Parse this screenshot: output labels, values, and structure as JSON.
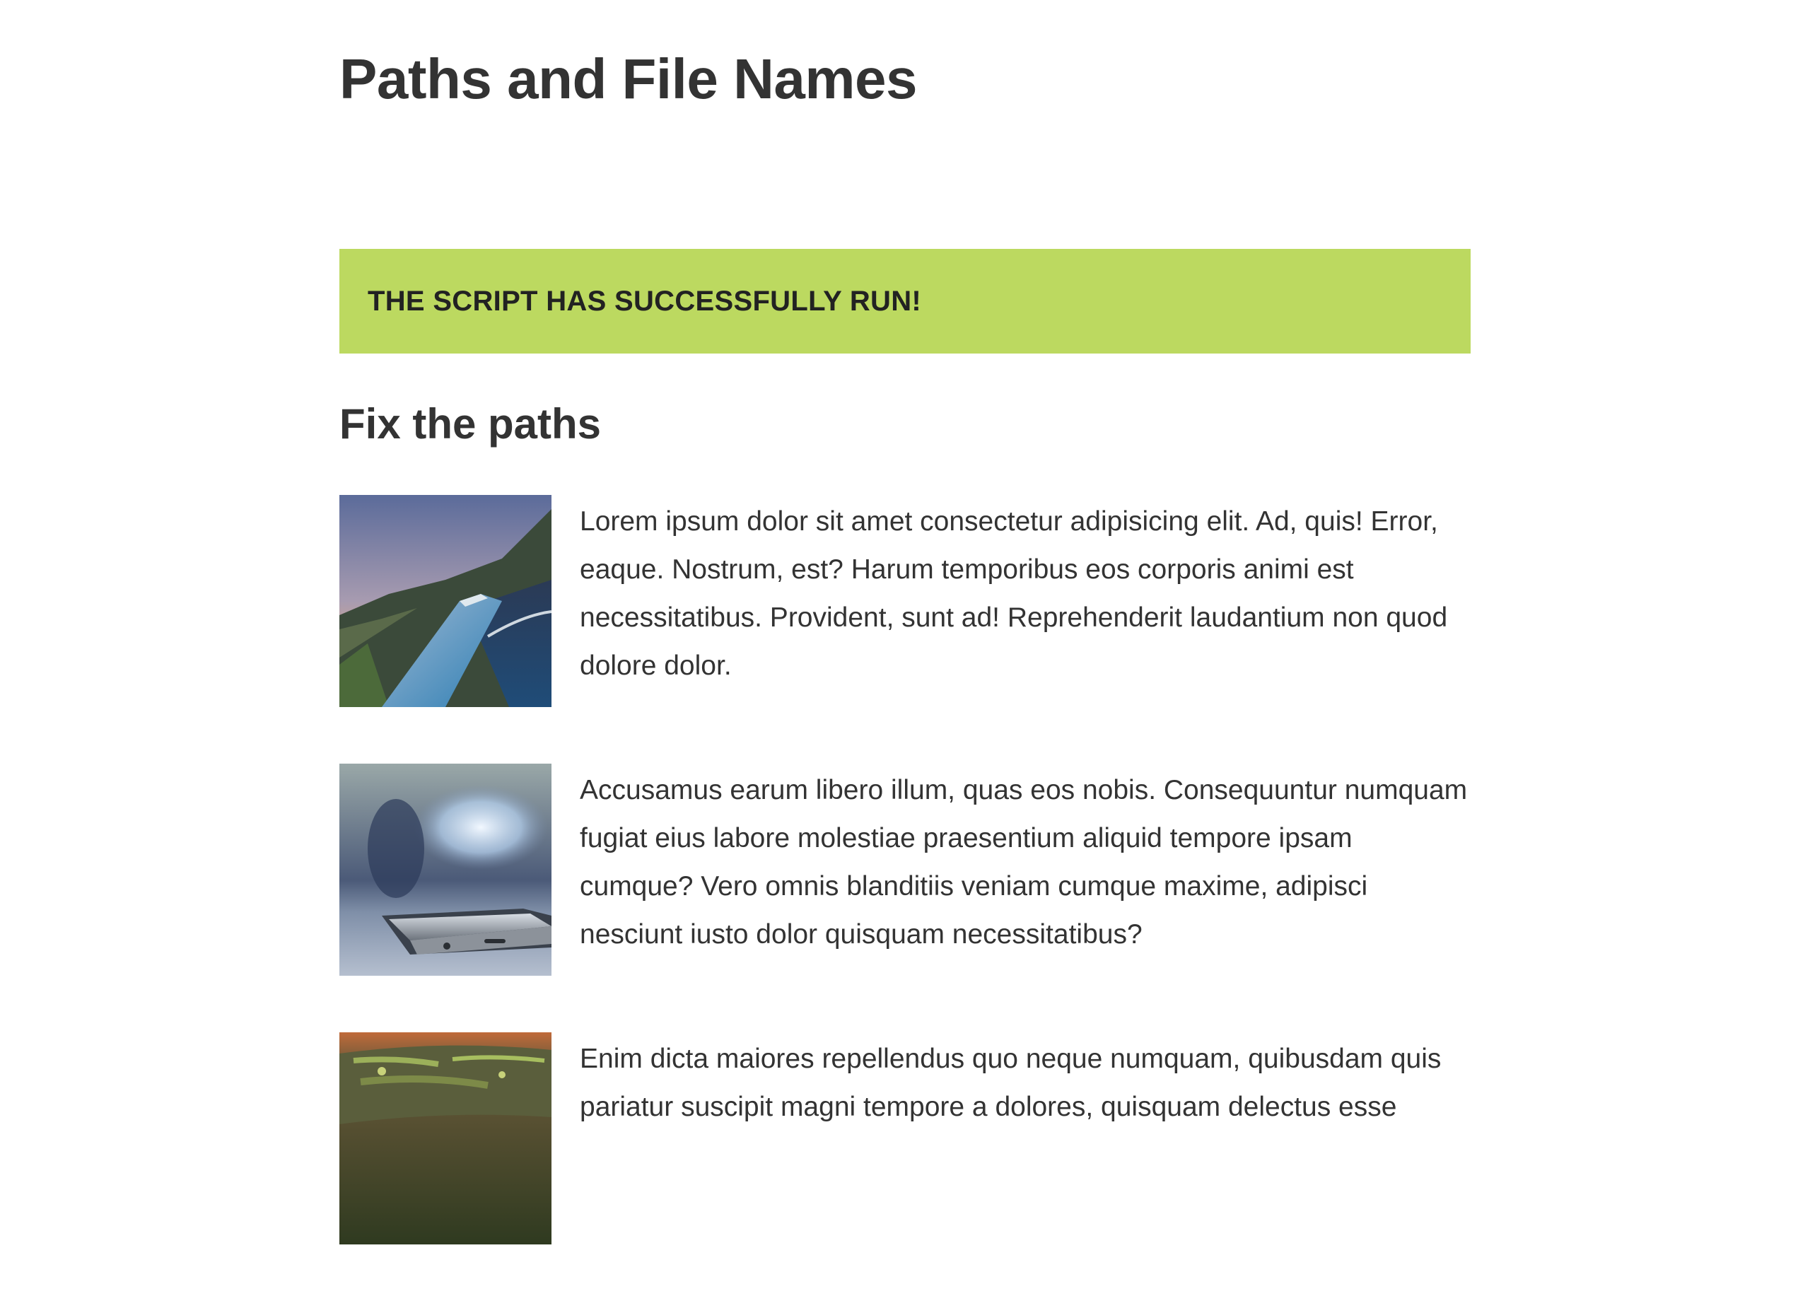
{
  "page": {
    "title": "Paths and File Names"
  },
  "banner": {
    "message": "THE SCRIPT HAS SUCCESSFULLY RUN!",
    "color": "#bcd960"
  },
  "section": {
    "title": "Fix the paths",
    "items": [
      {
        "image": "mountain-road-photo",
        "text": "Lorem ipsum dolor sit amet consectetur adipisicing elit. Ad, quis! Error, eaque. Nostrum, est? Harum temporibus eos corporis animi est necessitatibus. Provident, sunt ad! Reprehenderit laudantium non quod dolore dolor."
      },
      {
        "image": "smartphone-photo",
        "text": "Accusamus earum libero illum, quas eos nobis. Consequuntur numquam fugiat eius labore molestiae praesentium aliquid tempore ipsam cumque? Vero omnis blanditiis veniam cumque maxime, adipisci nesciunt iusto dolor quisquam necessitatibus?"
      },
      {
        "image": "mossy-log-photo",
        "text": "Enim dicta maiores repellendus quo neque numquam, quibusdam quis pariatur suscipit magni tempore a dolores, quisquam delectus esse"
      }
    ]
  }
}
